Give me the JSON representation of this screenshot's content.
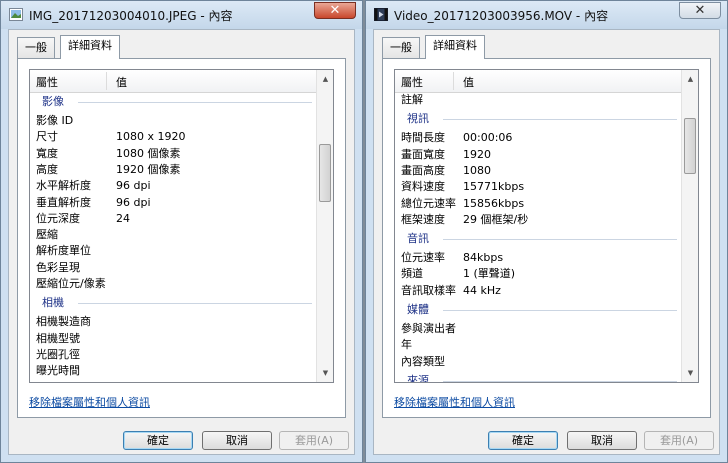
{
  "left": {
    "title": "IMG_20171203004010.JPEG - 內容",
    "close_label": "✕",
    "tabs": [
      "一般",
      "詳細資料"
    ],
    "columns": [
      "屬性",
      "值"
    ],
    "rows": [
      {
        "type": "group",
        "label": "影像"
      },
      {
        "type": "prop",
        "name": "影像 ID",
        "value": ""
      },
      {
        "type": "prop",
        "name": "尺寸",
        "value": "1080 x 1920"
      },
      {
        "type": "prop",
        "name": "寬度",
        "value": "1080 個像素"
      },
      {
        "type": "prop",
        "name": "高度",
        "value": "1920 個像素"
      },
      {
        "type": "prop",
        "name": "水平解析度",
        "value": "96 dpi"
      },
      {
        "type": "prop",
        "name": "垂直解析度",
        "value": "96 dpi"
      },
      {
        "type": "prop",
        "name": "位元深度",
        "value": "24"
      },
      {
        "type": "prop",
        "name": "壓縮",
        "value": ""
      },
      {
        "type": "prop",
        "name": "解析度單位",
        "value": ""
      },
      {
        "type": "prop",
        "name": "色彩呈現",
        "value": ""
      },
      {
        "type": "prop",
        "name": "壓縮位元/像素",
        "value": ""
      },
      {
        "type": "group",
        "label": "相機"
      },
      {
        "type": "prop",
        "name": "相機製造商",
        "value": ""
      },
      {
        "type": "prop",
        "name": "相機型號",
        "value": ""
      },
      {
        "type": "prop",
        "name": "光圈孔徑",
        "value": ""
      },
      {
        "type": "prop",
        "name": "曝光時間",
        "value": ""
      }
    ],
    "link": "移除檔案屬性和個人資訊",
    "buttons": {
      "ok": "確定",
      "cancel": "取消",
      "apply": "套用(A)"
    }
  },
  "right": {
    "title": "Video_20171203003956.MOV - 內容",
    "close_label": "✕",
    "tabs": [
      "一般",
      "詳細資料"
    ],
    "columns": [
      "屬性",
      "值"
    ],
    "rows": [
      {
        "type": "prop",
        "name": "註解",
        "value": ""
      },
      {
        "type": "group",
        "label": "視訊"
      },
      {
        "type": "prop",
        "name": "時間長度",
        "value": "00:00:06"
      },
      {
        "type": "prop",
        "name": "畫面寬度",
        "value": "1920"
      },
      {
        "type": "prop",
        "name": "畫面高度",
        "value": "1080"
      },
      {
        "type": "prop",
        "name": "資料速度",
        "value": "15771kbps"
      },
      {
        "type": "prop",
        "name": "總位元速率",
        "value": "15856kbps"
      },
      {
        "type": "prop",
        "name": "框架速度",
        "value": "29 個框架/秒"
      },
      {
        "type": "group",
        "label": "音訊"
      },
      {
        "type": "prop",
        "name": "位元速率",
        "value": "84kbps"
      },
      {
        "type": "prop",
        "name": "頻道",
        "value": "1 (單聲道)"
      },
      {
        "type": "prop",
        "name": "音訊取樣率",
        "value": "44 kHz"
      },
      {
        "type": "group",
        "label": "媒體"
      },
      {
        "type": "prop",
        "name": "參與演出者",
        "value": ""
      },
      {
        "type": "prop",
        "name": "年",
        "value": ""
      },
      {
        "type": "prop",
        "name": "內容類型",
        "value": ""
      },
      {
        "type": "group",
        "label": "來源"
      }
    ],
    "link": "移除檔案屬性和個人資訊",
    "buttons": {
      "ok": "確定",
      "cancel": "取消",
      "apply": "套用(A)"
    }
  },
  "colors": {
    "group_label": "#1e3287",
    "link": "#0b4aa2",
    "close_button": "#c9472c"
  },
  "icons": {
    "left_app": "image-file-icon",
    "right_app": "video-file-icon"
  }
}
